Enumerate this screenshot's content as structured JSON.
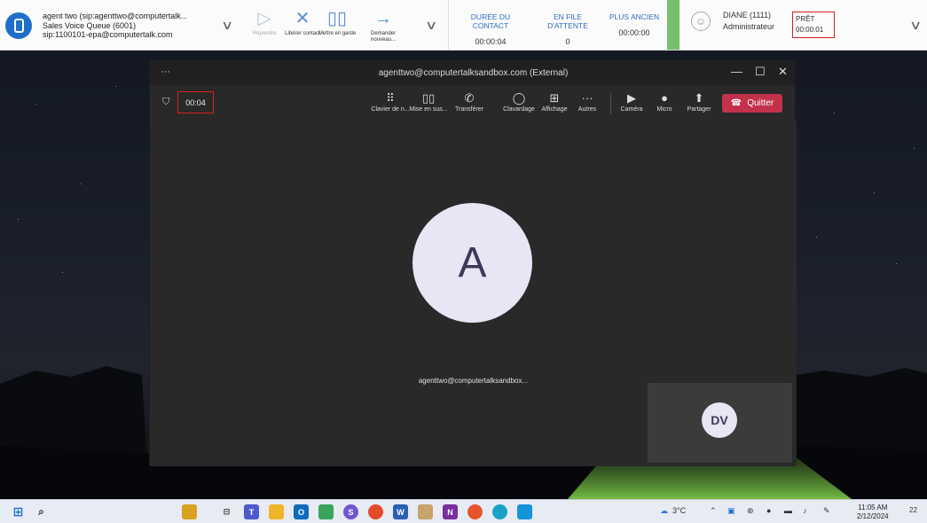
{
  "contact": {
    "line1": "agent two (sip:agenttwo@computertalk...",
    "line2": "Sales Voice Queue (6001)",
    "line3": "sip:1100101-epa@computertalk.com"
  },
  "toolbar": {
    "answer": "Répondre",
    "release": "Libérer contact",
    "hold": "Mettre en garde",
    "request": "Demander nouveau..."
  },
  "stats": {
    "duration_label": "DURÉE DU CONTACT",
    "duration_value": "00:00:04",
    "queue_label": "EN FILE D'ATTENTE",
    "queue_value": "0",
    "oldest_label": "PLUS ANCIEN",
    "oldest_value": "00:00:00"
  },
  "user": {
    "name": "DIANE (1111)",
    "role": "Administrateur",
    "status_label": "PRÊT",
    "status_time": "00:00:01"
  },
  "teams": {
    "title": "agenttwo@computertalksandbox.com (External)",
    "timer": "00:04",
    "buttons": {
      "keypad": "Clavier de n...",
      "hold": "Mise en sus...",
      "transfer": "Transférer",
      "chat": "Clavardage",
      "view": "Affichage",
      "more": "Autres",
      "camera": "Caméra",
      "mic": "Micro",
      "share": "Partager"
    },
    "quit": "Quitter",
    "remote_initial": "A",
    "remote_name": "agenttwo@computertalksandbox...",
    "self_initials": "DV"
  },
  "taskbar": {
    "temp": "3°C",
    "time": "11:05 AM",
    "date": "2/12/2024",
    "notif_count": "22"
  }
}
